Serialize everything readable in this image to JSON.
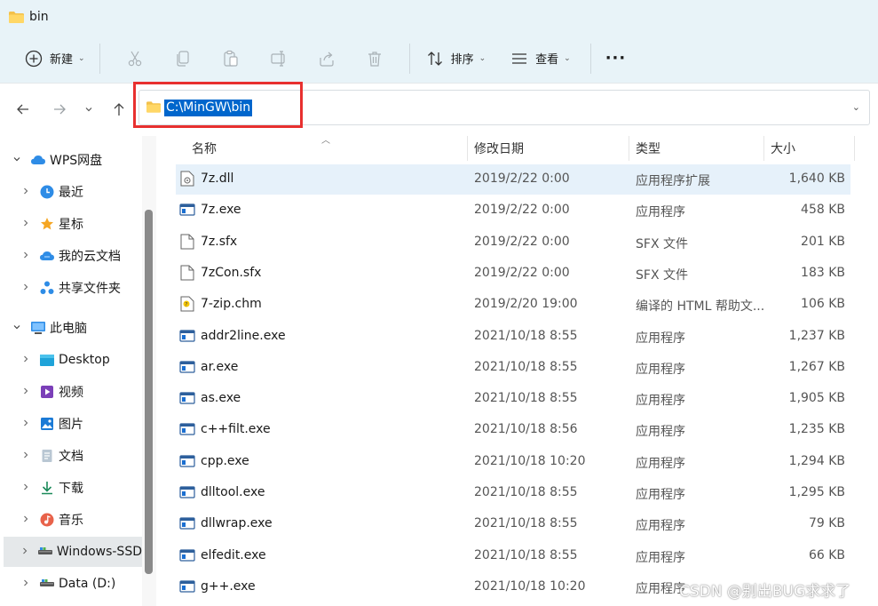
{
  "window": {
    "title": "bin"
  },
  "toolbar": {
    "new_label": "新建",
    "sort_label": "排序",
    "view_label": "查看",
    "more_label": "···"
  },
  "address": {
    "path": "C:\\MinGW\\bin"
  },
  "nav": {
    "items": [
      {
        "label": "WPS网盘",
        "icon": "cloud-icon",
        "expander": "expanded",
        "indent": 0
      },
      {
        "label": "最近",
        "icon": "clock-icon",
        "expander": "collapsed",
        "indent": 1
      },
      {
        "label": "星标",
        "icon": "star-icon",
        "expander": "collapsed",
        "indent": 1
      },
      {
        "label": "我的云文档",
        "icon": "cloud-docs-icon",
        "expander": "collapsed",
        "indent": 1
      },
      {
        "label": "共享文件夹",
        "icon": "share-folder-icon",
        "expander": "collapsed",
        "indent": 1
      },
      {
        "label": "此电脑",
        "icon": "computer-icon",
        "expander": "expanded",
        "indent": 0
      },
      {
        "label": "Desktop",
        "icon": "desktop-icon",
        "expander": "collapsed",
        "indent": 1
      },
      {
        "label": "视频",
        "icon": "video-icon",
        "expander": "collapsed",
        "indent": 1
      },
      {
        "label": "图片",
        "icon": "pictures-icon",
        "expander": "collapsed",
        "indent": 1
      },
      {
        "label": "文档",
        "icon": "documents-icon",
        "expander": "collapsed",
        "indent": 1
      },
      {
        "label": "下载",
        "icon": "download-icon",
        "expander": "collapsed",
        "indent": 1
      },
      {
        "label": "音乐",
        "icon": "music-icon",
        "expander": "collapsed",
        "indent": 1
      },
      {
        "label": "Windows-SSD",
        "icon": "drive-icon",
        "expander": "collapsed",
        "indent": 1,
        "selected": true
      },
      {
        "label": "Data (D:)",
        "icon": "drive-icon",
        "expander": "collapsed",
        "indent": 1
      }
    ]
  },
  "columns": {
    "name": "名称",
    "date": "修改日期",
    "type": "类型",
    "size": "大小"
  },
  "files": [
    {
      "name": "7z.dll",
      "date": "2019/2/22 0:00",
      "type": "应用程序扩展",
      "size": "1,640 KB",
      "icon": "dll-icon",
      "selected": true
    },
    {
      "name": "7z.exe",
      "date": "2019/2/22 0:00",
      "type": "应用程序",
      "size": "458 KB",
      "icon": "exe-icon"
    },
    {
      "name": "7z.sfx",
      "date": "2019/2/22 0:00",
      "type": "SFX 文件",
      "size": "201 KB",
      "icon": "file-icon"
    },
    {
      "name": "7zCon.sfx",
      "date": "2019/2/22 0:00",
      "type": "SFX 文件",
      "size": "183 KB",
      "icon": "file-icon"
    },
    {
      "name": "7-zip.chm",
      "date": "2019/2/20 19:00",
      "type": "编译的 HTML 帮助文...",
      "size": "106 KB",
      "icon": "chm-icon"
    },
    {
      "name": "addr2line.exe",
      "date": "2021/10/18 8:55",
      "type": "应用程序",
      "size": "1,237 KB",
      "icon": "exe-icon"
    },
    {
      "name": "ar.exe",
      "date": "2021/10/18 8:55",
      "type": "应用程序",
      "size": "1,267 KB",
      "icon": "exe-icon"
    },
    {
      "name": "as.exe",
      "date": "2021/10/18 8:55",
      "type": "应用程序",
      "size": "1,905 KB",
      "icon": "exe-icon"
    },
    {
      "name": "c++filt.exe",
      "date": "2021/10/18 8:56",
      "type": "应用程序",
      "size": "1,235 KB",
      "icon": "exe-icon"
    },
    {
      "name": "cpp.exe",
      "date": "2021/10/18 10:20",
      "type": "应用程序",
      "size": "1,294 KB",
      "icon": "exe-icon"
    },
    {
      "name": "dlltool.exe",
      "date": "2021/10/18 8:55",
      "type": "应用程序",
      "size": "1,295 KB",
      "icon": "exe-icon"
    },
    {
      "name": "dllwrap.exe",
      "date": "2021/10/18 8:55",
      "type": "应用程序",
      "size": "79 KB",
      "icon": "exe-icon"
    },
    {
      "name": "elfedit.exe",
      "date": "2021/10/18 8:55",
      "type": "应用程序",
      "size": "66 KB",
      "icon": "exe-icon"
    },
    {
      "name": "g++.exe",
      "date": "2021/10/18 10:20",
      "type": "应用程序",
      "size": "",
      "icon": "exe-icon"
    }
  ],
  "watermark": "CSDN @别出BUG求求了",
  "colors": {
    "accent": "#0066cc",
    "highlight_box": "#e8302f",
    "toolbar_bg": "#e8f3f8",
    "selected_row": "#e6f1fa"
  }
}
